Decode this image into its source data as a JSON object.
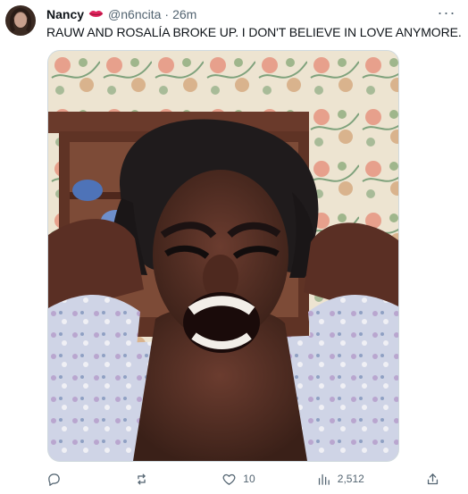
{
  "tweet": {
    "author": {
      "display_name": "Nancy",
      "handle": "@n6ncita",
      "separator": "·",
      "time": "26m",
      "badge_icon": "lips-icon"
    },
    "text": "RAUW AND ROSALÍA BROKE UP. I DON'T BELIEVE IN LOVE ANYMORE.",
    "more_label": "···",
    "actions": {
      "reply_count": "",
      "retweet_count": "",
      "like_count": "10",
      "views_count": "2,512"
    }
  },
  "colors": {
    "text": "#0f1419",
    "secondary": "#536471",
    "border": "#cfd9de",
    "lips": "#e0245e"
  }
}
